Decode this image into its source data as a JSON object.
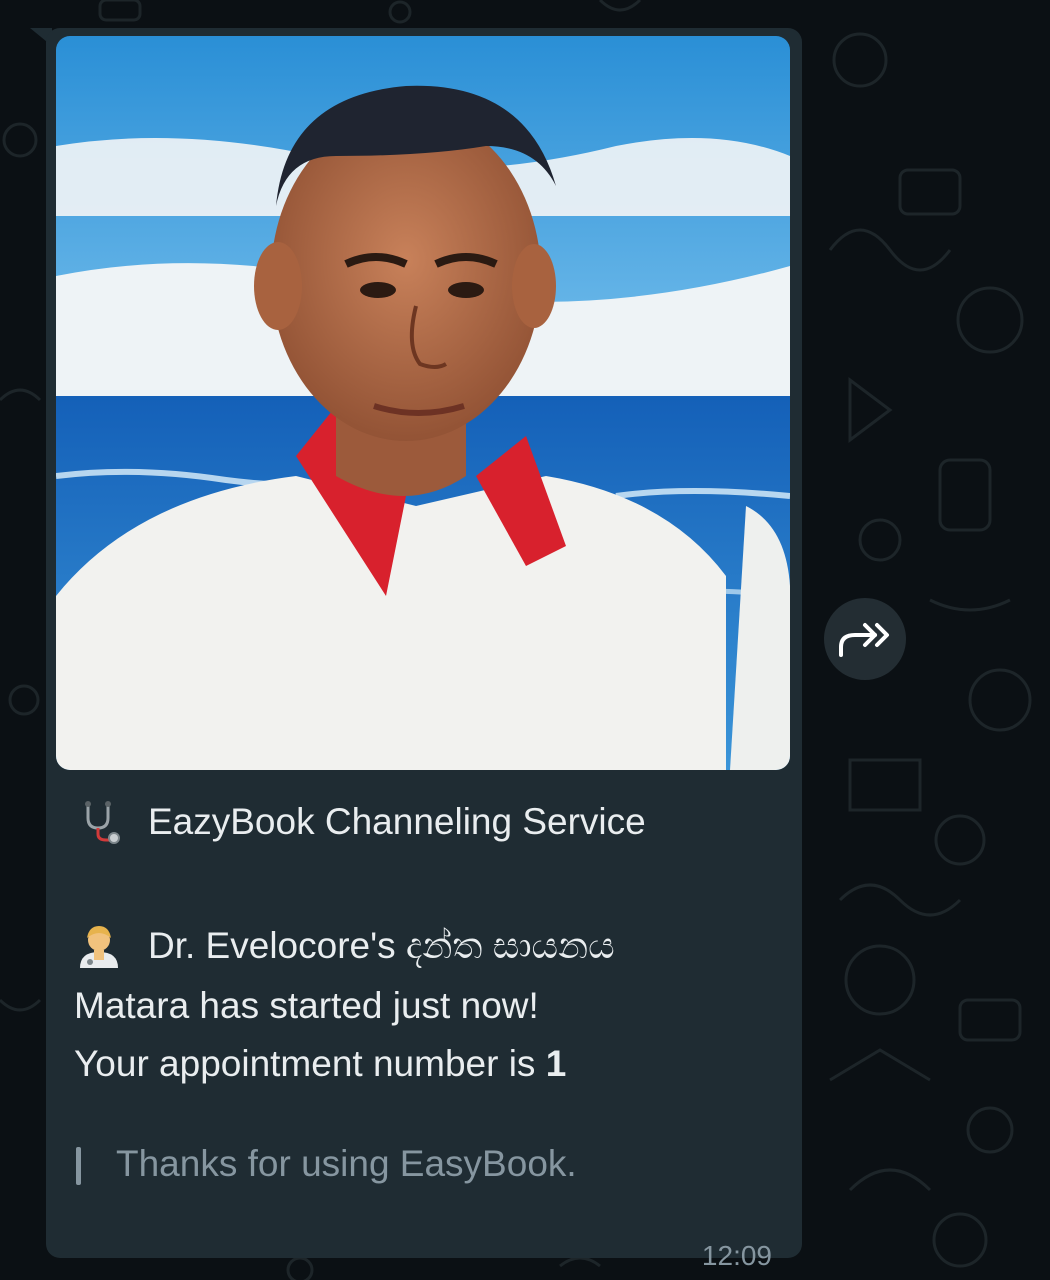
{
  "message": {
    "photo_description_icon": "sender-photo",
    "title_emoji": "stethoscope-emoji",
    "title": "EazyBook Channeling Service",
    "doctor_emoji": "man-health-worker-emoji",
    "doctor_line": "Dr. Evelocore's දන්ත සායනය",
    "location_line": "Matara has started just now!",
    "appointment_prefix": "Your appointment number is ",
    "appointment_number": "1",
    "quote": "Thanks for using EasyBook.",
    "time": "12:09"
  },
  "actions": {
    "forward_icon": "forward-icon"
  },
  "colors": {
    "bubble": "#1f2c33",
    "background": "#0b1014",
    "text": "#e9edef",
    "muted": "#8696a0"
  }
}
